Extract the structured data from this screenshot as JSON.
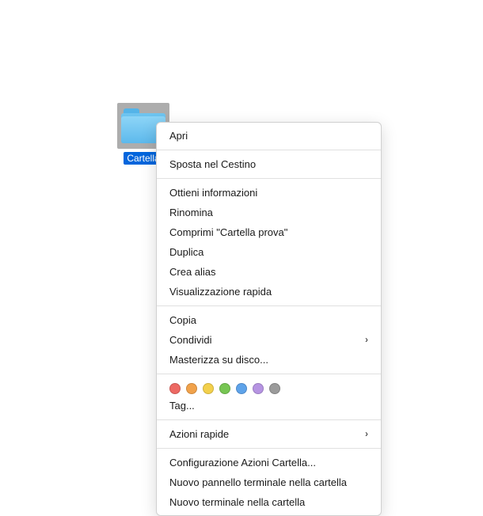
{
  "folder": {
    "label": "Cartella"
  },
  "menu": {
    "open": "Apri",
    "move_to_trash": "Sposta nel Cestino",
    "get_info": "Ottieni informazioni",
    "rename": "Rinomina",
    "compress": "Comprimi \"Cartella prova\"",
    "duplicate": "Duplica",
    "make_alias": "Crea alias",
    "quick_look": "Visualizzazione rapida",
    "copy": "Copia",
    "share": "Condividi",
    "burn": "Masterizza su disco...",
    "tag": "Tag...",
    "quick_actions": "Azioni rapide",
    "folder_actions_setup": "Configurazione Azioni Cartella...",
    "new_terminal_tab": "Nuovo pannello terminale nella cartella",
    "new_terminal": "Nuovo terminale nella cartella"
  },
  "tags": {
    "colors": [
      "#ed6963",
      "#f1a24b",
      "#f3d04c",
      "#77c653",
      "#5ea3ea",
      "#b694e2",
      "#9b9b9b"
    ]
  }
}
